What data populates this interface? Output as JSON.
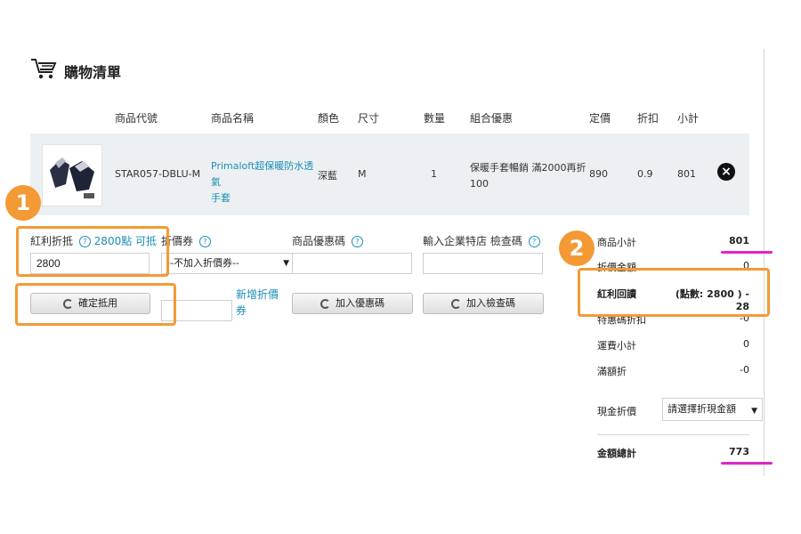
{
  "header": {
    "title": "購物清單",
    "cart_icon": "cart-icon"
  },
  "table": {
    "headers": [
      "商品代號",
      "商品名稱",
      "顏色",
      "尺寸",
      "數量",
      "組合優惠",
      "定價",
      "折扣",
      "小計"
    ],
    "row": {
      "code": "STAR057-DBLU-M",
      "name_line1": "Primaloft超保暖防水透氣",
      "name_line2": "手套",
      "color": "深藍",
      "size": "M",
      "qty": "1",
      "promo_line1": "保暖手套暢銷 滿2000再折",
      "promo_line2": "100",
      "price": "890",
      "discount": "0.9",
      "subtotal": "801",
      "delete_icon": "close-icon"
    }
  },
  "bonus": {
    "label": "紅利折抵",
    "points": "2800點",
    "can_use": "可抵",
    "value": "2800",
    "confirm_label": "確定抵用"
  },
  "coupon": {
    "label": "折價券",
    "selected": "--不加入折價券--",
    "add_link_line1": "新增折價",
    "add_link_line2": "券"
  },
  "product_coupon": {
    "label": "商品優惠碼",
    "button": "加入優惠碼"
  },
  "company_code": {
    "label": "輸入企業特店 檢查碼",
    "button": "加入檢查碼"
  },
  "summary": {
    "product_subtotal_label": "商品小計",
    "product_subtotal": "801",
    "coupon_amount_label": "折價金額",
    "coupon_amount": "0",
    "bonus_label": "紅利回讀",
    "bonus_value": "(點數: 2800 ) - 28",
    "special_label": "特惠碼折扣",
    "special_value": "-0",
    "shipping_label": "運費小計",
    "shipping_value": "0",
    "full_discount_label": "滿額折",
    "full_discount_value": "-0",
    "cash_label": "現金折價",
    "cash_select": "請選擇折現金額",
    "total_label": "金額總計",
    "total_value": "773"
  },
  "callouts": {
    "one": "1",
    "two": "2"
  },
  "colors": {
    "accent_orange": "#f39a35",
    "link_blue": "#1a8fb5",
    "highlight_pink": "#e523c8"
  }
}
